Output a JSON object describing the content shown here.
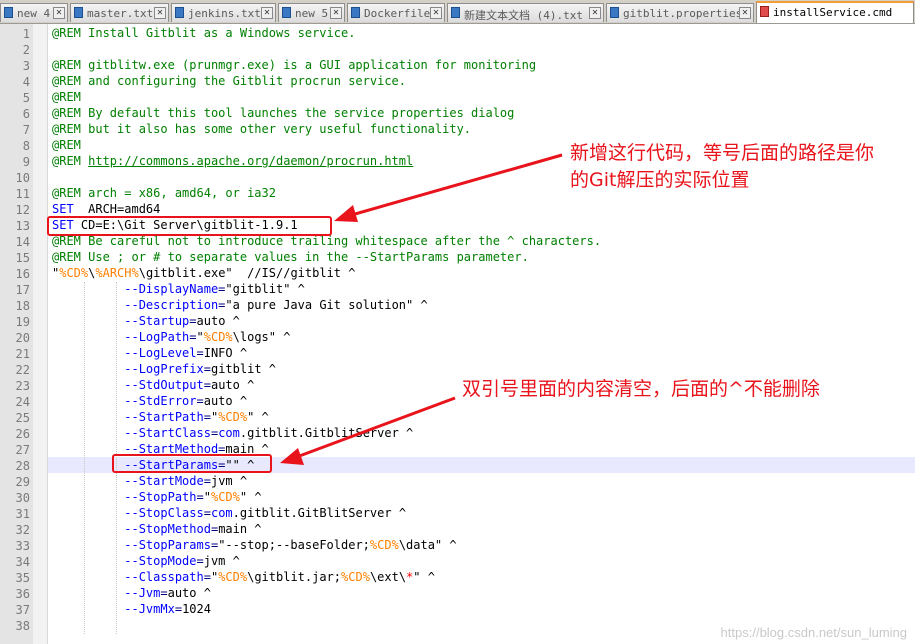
{
  "tabs": [
    {
      "label": "new 4",
      "active": false,
      "icon": "file-icon-blue"
    },
    {
      "label": "master.txt",
      "active": false,
      "icon": "file-icon-blue"
    },
    {
      "label": "jenkins.txt",
      "active": false,
      "icon": "file-icon-blue"
    },
    {
      "label": "new 5",
      "active": false,
      "icon": "file-icon-blue"
    },
    {
      "label": "Dockerfile",
      "active": false,
      "icon": "file-icon-blue"
    },
    {
      "label": "新建文本文档 (4).txt",
      "active": false,
      "icon": "file-icon-blue"
    },
    {
      "label": "gitblit.properties",
      "active": false,
      "icon": "file-icon-blue"
    },
    {
      "label": "installService.cmd",
      "active": true,
      "icon": "file-icon-red"
    }
  ],
  "editor": {
    "current_line": 28,
    "lines": [
      {
        "n": "1",
        "segs": [
          [
            "c-cmt",
            "@REM Install Gitblit as a Windows service."
          ]
        ]
      },
      {
        "n": "2",
        "segs": []
      },
      {
        "n": "3",
        "segs": [
          [
            "c-cmt",
            "@REM gitblitw.exe (prunmgr.exe) is a GUI application for monitoring"
          ]
        ]
      },
      {
        "n": "4",
        "segs": [
          [
            "c-cmt",
            "@REM and configuring the Gitblit procrun service."
          ]
        ]
      },
      {
        "n": "5",
        "segs": [
          [
            "c-cmt",
            "@REM"
          ]
        ]
      },
      {
        "n": "6",
        "segs": [
          [
            "c-cmt",
            "@REM By default this tool launches the service properties dialog"
          ]
        ]
      },
      {
        "n": "7",
        "segs": [
          [
            "c-cmt",
            "@REM but it also has some other very useful functionality."
          ]
        ]
      },
      {
        "n": "8",
        "segs": [
          [
            "c-cmt",
            "@REM"
          ]
        ]
      },
      {
        "n": "9",
        "segs": [
          [
            "c-cmt",
            "@REM "
          ],
          [
            "c-link",
            "http://commons.apache.org/daemon/procrun.html"
          ]
        ]
      },
      {
        "n": "10",
        "segs": []
      },
      {
        "n": "11",
        "segs": [
          [
            "c-cmt",
            "@REM arch = x86, amd64, or ia32"
          ]
        ]
      },
      {
        "n": "12",
        "segs": [
          [
            "c-kw",
            "SET"
          ],
          [
            "",
            "  ARCH=amd64"
          ]
        ]
      },
      {
        "n": "13",
        "segs": [
          [
            "c-kw",
            "SET"
          ],
          [
            "",
            " CD=E:\\Git Server\\gitblit-1.9.1"
          ]
        ]
      },
      {
        "n": "14",
        "segs": [
          [
            "c-cmt",
            "@REM Be careful not to introduce trailing whitespace after the ^ characters."
          ]
        ]
      },
      {
        "n": "15",
        "segs": [
          [
            "c-cmt",
            "@REM Use ; or # to separate values in the --StartParams parameter."
          ]
        ]
      },
      {
        "n": "16",
        "segs": [
          [
            "",
            "\""
          ],
          [
            "c-var",
            "%CD%"
          ],
          [
            "",
            "\\"
          ],
          [
            "c-var",
            "%ARCH%"
          ],
          [
            "",
            "\\gitblit.exe\"  //IS//gitblit ^"
          ]
        ]
      },
      {
        "n": "17",
        "segs": [
          [
            "",
            "          "
          ],
          [
            "c-opt",
            "--DisplayName"
          ],
          [
            "c-eq",
            "="
          ],
          [
            "",
            "\"gitblit\" ^"
          ]
        ]
      },
      {
        "n": "18",
        "segs": [
          [
            "",
            "          "
          ],
          [
            "c-opt",
            "--Description"
          ],
          [
            "c-eq",
            "="
          ],
          [
            "",
            "\"a pure Java Git solution\" ^"
          ]
        ]
      },
      {
        "n": "19",
        "segs": [
          [
            "",
            "          "
          ],
          [
            "c-opt",
            "--Startup"
          ],
          [
            "c-eq",
            "="
          ],
          [
            "",
            "auto ^"
          ]
        ]
      },
      {
        "n": "20",
        "segs": [
          [
            "",
            "          "
          ],
          [
            "c-opt",
            "--LogPath"
          ],
          [
            "c-eq",
            "="
          ],
          [
            "",
            "\""
          ],
          [
            "c-var",
            "%CD%"
          ],
          [
            "",
            "\\logs\" ^"
          ]
        ]
      },
      {
        "n": "21",
        "segs": [
          [
            "",
            "          "
          ],
          [
            "c-opt",
            "--LogLevel"
          ],
          [
            "c-eq",
            "="
          ],
          [
            "",
            "INFO ^"
          ]
        ]
      },
      {
        "n": "22",
        "segs": [
          [
            "",
            "          "
          ],
          [
            "c-opt",
            "--LogPrefix"
          ],
          [
            "c-eq",
            "="
          ],
          [
            "",
            "gitblit ^"
          ]
        ]
      },
      {
        "n": "23",
        "segs": [
          [
            "",
            "          "
          ],
          [
            "c-opt",
            "--StdOutput"
          ],
          [
            "c-eq",
            "="
          ],
          [
            "",
            "auto ^"
          ]
        ]
      },
      {
        "n": "24",
        "segs": [
          [
            "",
            "          "
          ],
          [
            "c-opt",
            "--StdError"
          ],
          [
            "c-eq",
            "="
          ],
          [
            "",
            "auto ^"
          ]
        ]
      },
      {
        "n": "25",
        "segs": [
          [
            "",
            "          "
          ],
          [
            "c-opt",
            "--StartPath"
          ],
          [
            "c-eq",
            "="
          ],
          [
            "",
            "\""
          ],
          [
            "c-var",
            "%CD%"
          ],
          [
            "",
            "\" ^"
          ]
        ]
      },
      {
        "n": "26",
        "segs": [
          [
            "",
            "          "
          ],
          [
            "c-opt",
            "--StartClass"
          ],
          [
            "c-eq",
            "="
          ],
          [
            "c-kw",
            "com"
          ],
          [
            "",
            ".gitblit.GitblitServer ^"
          ]
        ]
      },
      {
        "n": "27",
        "segs": [
          [
            "",
            "          "
          ],
          [
            "c-opt",
            "--StartMethod"
          ],
          [
            "c-eq",
            "="
          ],
          [
            "",
            "main ^"
          ]
        ]
      },
      {
        "n": "28",
        "segs": [
          [
            "",
            "          "
          ],
          [
            "c-opt",
            "--StartParams"
          ],
          [
            "c-eq",
            "="
          ],
          [
            "",
            "\"\" ^"
          ]
        ]
      },
      {
        "n": "29",
        "segs": [
          [
            "",
            "          "
          ],
          [
            "c-opt",
            "--StartMode"
          ],
          [
            "c-eq",
            "="
          ],
          [
            "",
            "jvm ^"
          ]
        ]
      },
      {
        "n": "30",
        "segs": [
          [
            "",
            "          "
          ],
          [
            "c-opt",
            "--StopPath"
          ],
          [
            "c-eq",
            "="
          ],
          [
            "",
            "\""
          ],
          [
            "c-var",
            "%CD%"
          ],
          [
            "",
            "\" ^"
          ]
        ]
      },
      {
        "n": "31",
        "segs": [
          [
            "",
            "          "
          ],
          [
            "c-opt",
            "--StopClass"
          ],
          [
            "c-eq",
            "="
          ],
          [
            "c-kw",
            "com"
          ],
          [
            "",
            ".gitblit.GitBlitServer ^"
          ]
        ]
      },
      {
        "n": "32",
        "segs": [
          [
            "",
            "          "
          ],
          [
            "c-opt",
            "--StopMethod"
          ],
          [
            "c-eq",
            "="
          ],
          [
            "",
            "main ^"
          ]
        ]
      },
      {
        "n": "33",
        "segs": [
          [
            "",
            "          "
          ],
          [
            "c-opt",
            "--StopParams"
          ],
          [
            "c-eq",
            "="
          ],
          [
            "",
            "\"--stop;--baseFolder;"
          ],
          [
            "c-var",
            "%CD%"
          ],
          [
            "",
            "\\data\" ^"
          ]
        ]
      },
      {
        "n": "34",
        "segs": [
          [
            "",
            "          "
          ],
          [
            "c-opt",
            "--StopMode"
          ],
          [
            "c-eq",
            "="
          ],
          [
            "",
            "jvm ^"
          ]
        ]
      },
      {
        "n": "35",
        "segs": [
          [
            "",
            "          "
          ],
          [
            "c-opt",
            "--Classpath"
          ],
          [
            "c-eq",
            "="
          ],
          [
            "",
            "\""
          ],
          [
            "c-var",
            "%CD%"
          ],
          [
            "",
            "\\gitblit.jar;"
          ],
          [
            "c-var",
            "%CD%"
          ],
          [
            "",
            "\\ext\\"
          ],
          [
            "c-star",
            "*"
          ],
          [
            "",
            "\" ^"
          ]
        ]
      },
      {
        "n": "36",
        "segs": [
          [
            "",
            "          "
          ],
          [
            "c-opt",
            "--Jvm"
          ],
          [
            "c-eq",
            "="
          ],
          [
            "",
            "auto ^"
          ]
        ]
      },
      {
        "n": "37",
        "segs": [
          [
            "",
            "          "
          ],
          [
            "c-opt",
            "--JvmMx"
          ],
          [
            "c-eq",
            "="
          ],
          [
            "",
            "1024"
          ]
        ]
      },
      {
        "n": "38",
        "segs": []
      }
    ]
  },
  "annotations": {
    "note1_line1": "新增这行代码，等号后面的路径是你",
    "note1_line2": "的Git解压的实际位置",
    "note2": "双引号里面的内容清空，后面的^不能删除",
    "color": "#e8131b"
  },
  "watermark": "https://blog.csdn.net/sun_luming"
}
